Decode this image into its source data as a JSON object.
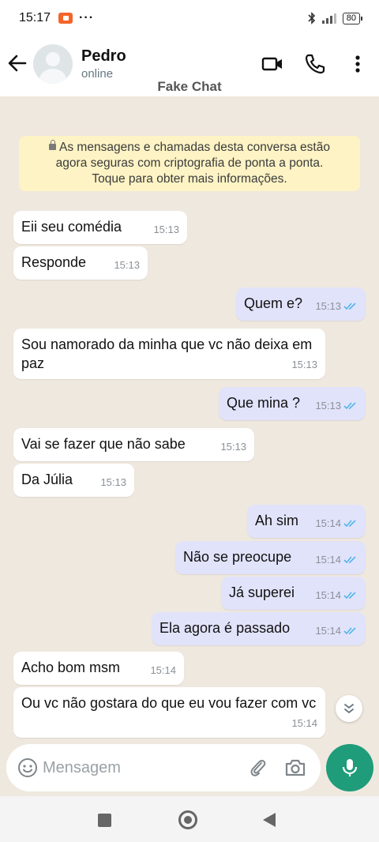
{
  "status_bar": {
    "time": "15:17",
    "dots": "···",
    "battery": "80"
  },
  "header": {
    "contact_name": "Pedro",
    "contact_status": "online",
    "overlay_title": "Fake Chat"
  },
  "chat": {
    "notice": [
      "As mensagens e chamadas desta conversa estão",
      "agora seguras com criptografia de ponta a ponta.",
      "Toque para obter mais informações."
    ],
    "messages": [
      {
        "dir": "in",
        "text": "Eii seu comédia",
        "time": "15:13"
      },
      {
        "dir": "in",
        "text": "Responde",
        "time": "15:13"
      },
      {
        "dir": "out",
        "text": "Quem e?",
        "time": "15:13",
        "read": true
      },
      {
        "dir": "in",
        "text": "Sou namorado da minha que vc não deixa em paz",
        "time": "15:13"
      },
      {
        "dir": "out",
        "text": "Que mina ?",
        "time": "15:13",
        "read": true
      },
      {
        "dir": "in",
        "text": "Vai se fazer que não sabe",
        "time": "15:13"
      },
      {
        "dir": "in",
        "text": "Da Júlia",
        "time": "15:13"
      },
      {
        "dir": "out",
        "text": "Ah sim",
        "time": "15:14",
        "read": true
      },
      {
        "dir": "out",
        "text": "Não se preocupe",
        "time": "15:14",
        "read": true
      },
      {
        "dir": "out",
        "text": "Já superei",
        "time": "15:14",
        "read": true
      },
      {
        "dir": "out",
        "text": "Ela agora é passado",
        "time": "15:14",
        "read": true
      },
      {
        "dir": "in",
        "text": "Acho bom msm",
        "time": "15:14"
      },
      {
        "dir": "in",
        "text": "Ou vc não gostara do que eu vou fazer com vc",
        "time": "15:14"
      }
    ]
  },
  "composer": {
    "placeholder": "Mensagem"
  },
  "colors": {
    "accent": "#1f9c7a",
    "read_ticks": "#4fb6ec",
    "outgoing_bubble": "#e1e3fb",
    "notice_bg": "#fdf3c5"
  }
}
